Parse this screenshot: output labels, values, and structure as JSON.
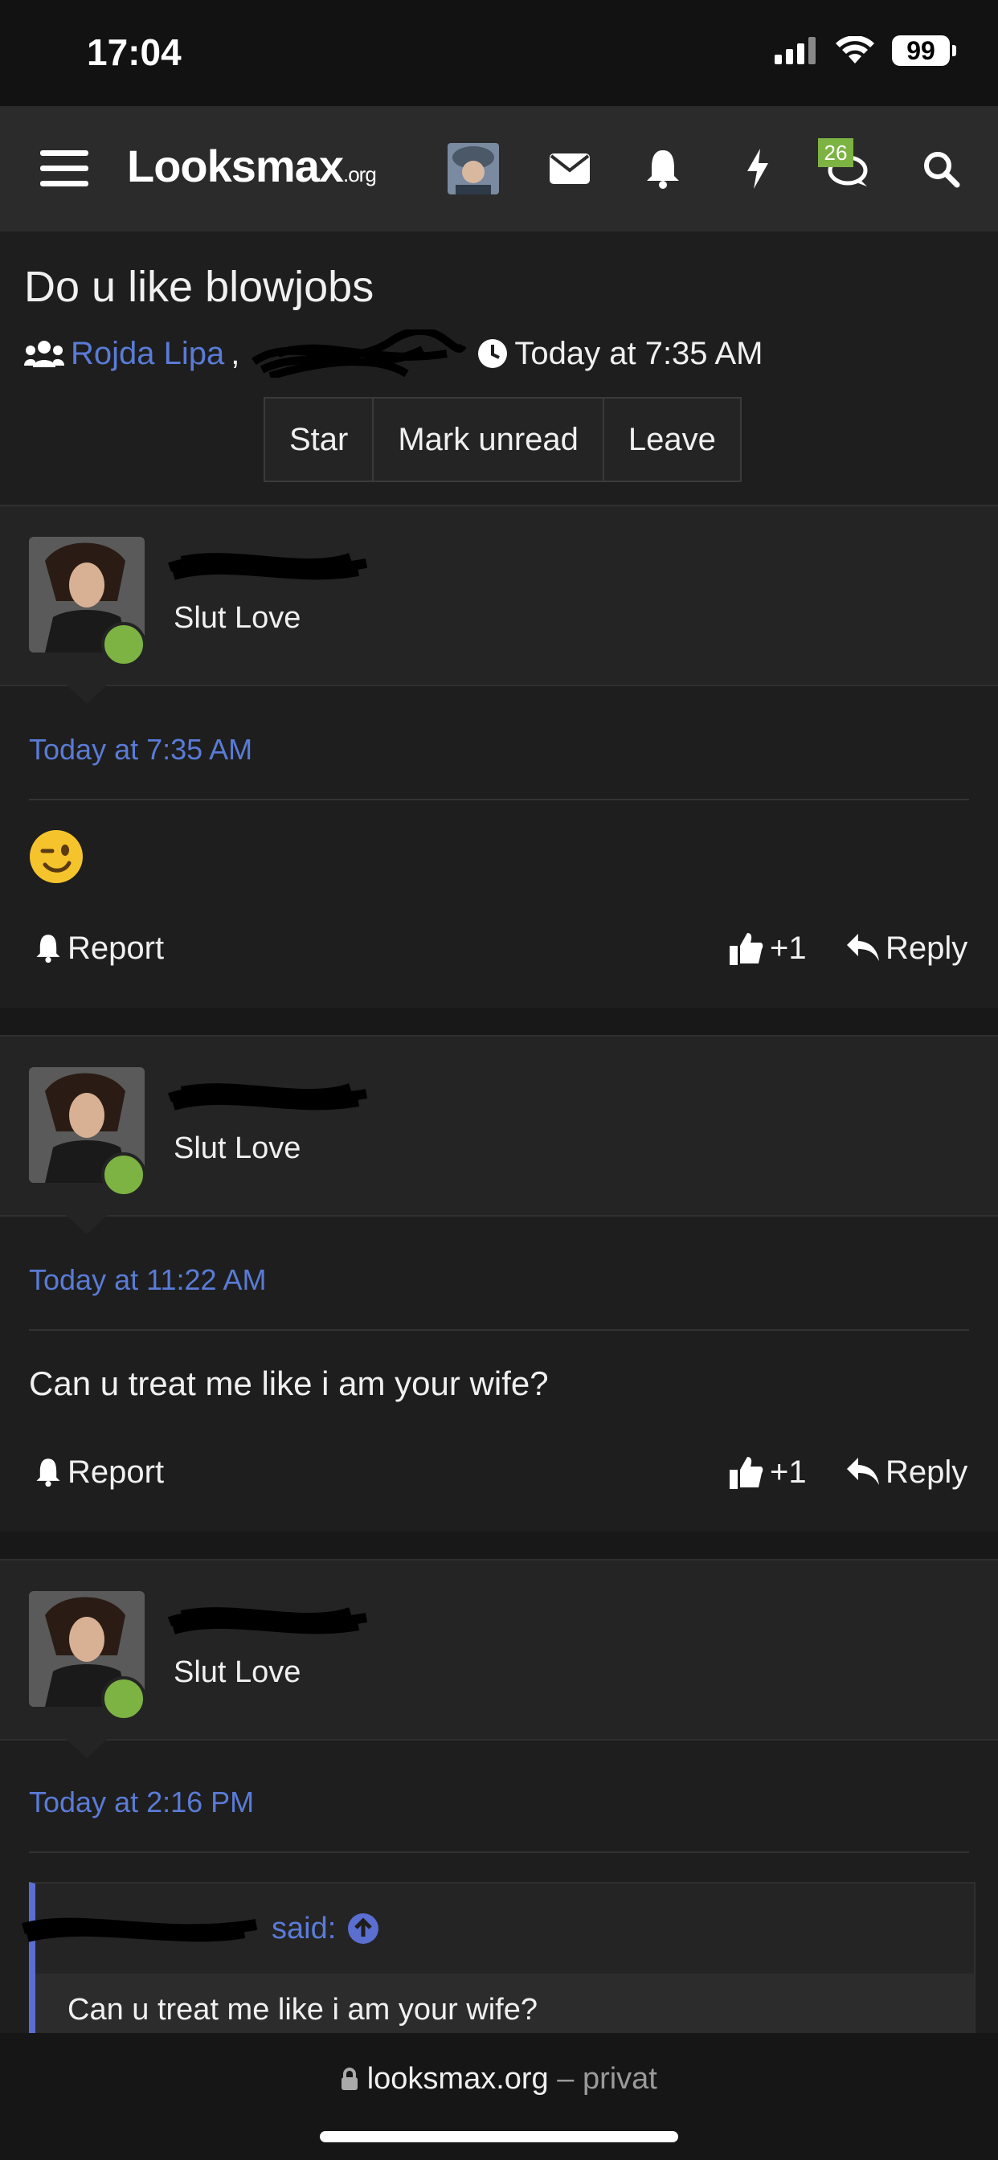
{
  "status_bar": {
    "time": "17:04",
    "battery": "99"
  },
  "nav": {
    "logo_main": "Looksmax",
    "logo_suffix": ".org",
    "conversations_badge": "26",
    "icons": [
      "menu-icon",
      "avatar",
      "envelope-icon",
      "bell-icon",
      "bolt-icon",
      "conversations-icon",
      "search-icon"
    ]
  },
  "thread": {
    "title": "Do u like blowjobs",
    "participant": "Rojda Lipa",
    "comma": ",",
    "started": "Today at 7:35 AM",
    "buttons": {
      "star": "Star",
      "mark_unread": "Mark unread",
      "leave": "Leave"
    }
  },
  "messages": [
    {
      "role": "Slut Love",
      "time": "Today at 7:35 AM",
      "body": "😉",
      "report": "Report",
      "likes": "+1",
      "reply": "Reply"
    },
    {
      "role": "Slut Love",
      "time": "Today at 11:22 AM",
      "body": "Can u treat me like i am your wife?",
      "report": "Report",
      "likes": "+1",
      "reply": "Reply"
    },
    {
      "role": "Slut Love",
      "time": "Today at 2:16 PM",
      "quote_said": "said:",
      "quote_body": "Can u treat me like i am your wife?"
    }
  ],
  "browser": {
    "domain": "looksmax.org",
    "dash": " – ",
    "mode": "privat"
  },
  "colors": {
    "link": "#5a7bd6",
    "online": "#7cb342",
    "background": "#1e1e1e"
  }
}
